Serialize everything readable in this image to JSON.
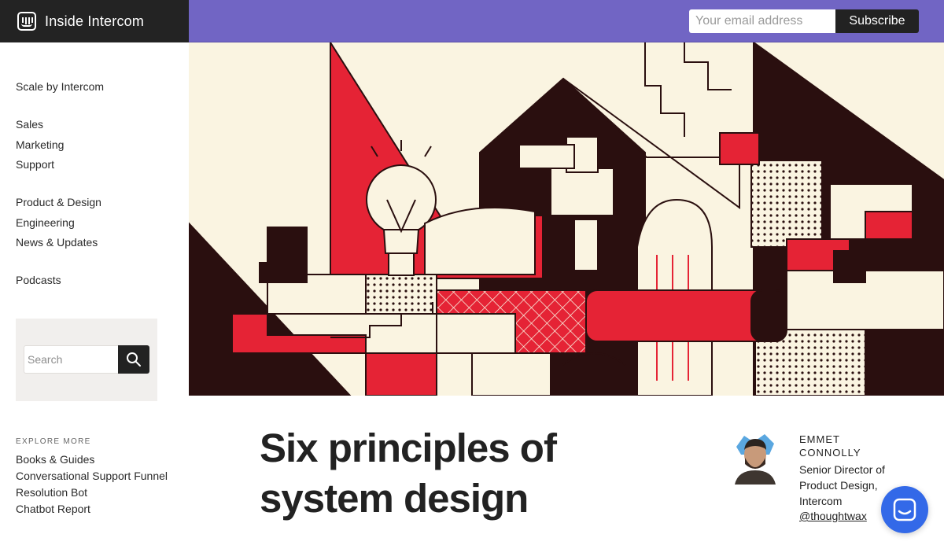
{
  "brand": {
    "name": "Inside Intercom",
    "icon": "intercom-logo-icon"
  },
  "header": {
    "email_placeholder": "Your email address",
    "subscribe_label": "Subscribe",
    "accent_color": "#7165c4"
  },
  "sidebar": {
    "groups": [
      [
        "Scale by Intercom"
      ],
      [
        "Sales",
        "Marketing",
        "Support"
      ],
      [
        "Product & Design",
        "Engineering",
        "News & Updates"
      ],
      [
        "Podcasts"
      ]
    ],
    "search": {
      "placeholder": "Search",
      "icon": "search-icon"
    },
    "explore": {
      "label": "EXPLORE MORE",
      "items": [
        "Books & Guides",
        "Conversational Support Funnel",
        "Resolution Bot",
        "Chatbot Report"
      ]
    }
  },
  "article": {
    "title": "Six principles of system design",
    "author": {
      "name": "EMMET CONNOLLY",
      "role": "Senior Director of Product Design, Intercom",
      "handle": "@thoughtwax"
    }
  },
  "colors": {
    "hero_red": "#e52335",
    "hero_dark": "#2a0f0f",
    "hero_cream": "#faf4e1",
    "chat_blue": "#3369e8"
  }
}
